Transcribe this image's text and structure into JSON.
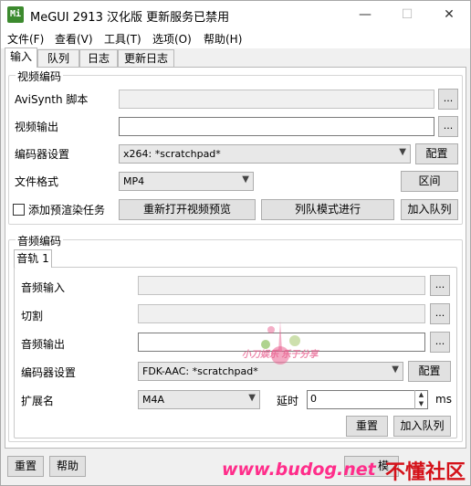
{
  "window": {
    "app_icon": "Mi",
    "title": "MeGUI 2913 汉化版 更新服务已禁用",
    "minimize": "—",
    "maximize": "☐",
    "close": "✕"
  },
  "menu": [
    "文件(F)",
    "查看(V)",
    "工具(T)",
    "选项(O)",
    "帮助(H)"
  ],
  "tabs": [
    "输入",
    "队列",
    "日志",
    "更新日志"
  ],
  "video": {
    "legend": "视频编码",
    "avisynth_label": "AviSynth 脚本",
    "avisynth_value": "",
    "output_label": "视频输出",
    "output_value": "",
    "encoder_label": "编码器设置",
    "encoder_value": "x264: *scratchpad*",
    "config_button": "配置",
    "format_label": "文件格式",
    "format_value": "MP4",
    "zone_button": "区间",
    "prerender_label": "添加预渲染任务",
    "reopen_preview_button": "重新打开视频预览",
    "queue_mode_button": "列队模式进行",
    "add_queue_button": "加入队列",
    "browse": "..."
  },
  "audio": {
    "legend": "音频编码",
    "track_tab": "音轨 1",
    "input_label": "音频输入",
    "cut_label": "切割",
    "output_label": "音频输出",
    "encoder_label": "编码器设置",
    "encoder_value": "FDK-AAC: *scratchpad*",
    "config_button": "配置",
    "ext_label": "扩展名",
    "ext_value": "M4A",
    "delay_label": "延时",
    "delay_value": "0",
    "delay_unit": "ms",
    "reset_button": "重置",
    "add_queue_button": "加入队列",
    "browse": "..."
  },
  "bottom": {
    "reset_button": "重置",
    "help_button": "帮助",
    "partial_button": "模"
  },
  "watermark": {
    "brand": "小刀娱乐 乐于分享",
    "url": "www.budog.net",
    "site": "不懂社区"
  },
  "colors": {
    "app_icon": "#3c8a2e",
    "watermark_url": "#ff2d8a",
    "watermark_site": "#d4121a"
  }
}
